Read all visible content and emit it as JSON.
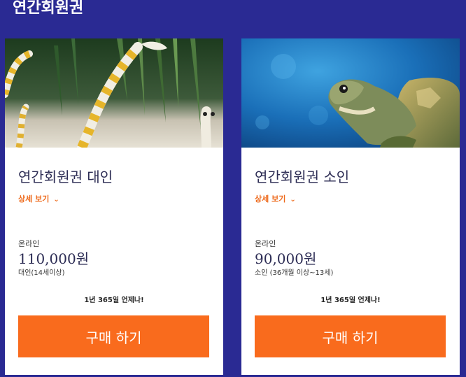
{
  "page": {
    "title": "연간회원권"
  },
  "cards": [
    {
      "name": "연간회원권 대인",
      "detail_label": "상세 보기",
      "channel": "온라인",
      "price": "110,000원",
      "condition": "대인(14세이상)",
      "tagline": "1년 365일 언제나!",
      "buy_label": "구매 하기",
      "image": "garden-eel-photo"
    },
    {
      "name": "연간회원권 소인",
      "detail_label": "상세 보기",
      "channel": "온라인",
      "price": "90,000원",
      "condition": "소인 (36개월 이상~13세)",
      "tagline": "1년 365일 언제나!",
      "buy_label": "구매 하기",
      "image": "sea-turtle-photo"
    }
  ],
  "colors": {
    "background": "#2a2a93",
    "accent": "#f96b1d",
    "text": "#2c2c54"
  }
}
